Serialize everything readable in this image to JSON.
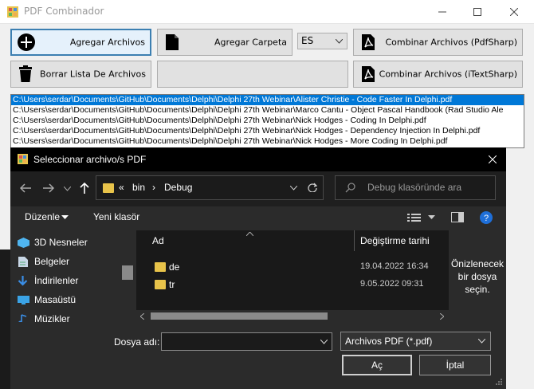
{
  "main": {
    "title": "PDF Combinador",
    "buttons": {
      "add_files": "Agregar Archivos",
      "add_folder": "Agregar Carpeta",
      "language": "ES",
      "combine_pdfsharp": "Combinar Archivos (PdfSharp)",
      "clear_list": "Borrar Lista De Archivos",
      "combine_itextsharp": "Combinar Archivos (iTextSharp)"
    },
    "files": [
      "C:\\Users\\serdar\\Documents\\GitHub\\Documents\\Delphi\\Delphi 27th Webinar\\Alister Christie - Code Faster In Delphi.pdf",
      "C:\\Users\\serdar\\Documents\\GitHub\\Documents\\Delphi\\Delphi 27th Webinar\\Marco Cantu - Object Pascal Handbook (Rad Studio Ale",
      "C:\\Users\\serdar\\Documents\\GitHub\\Documents\\Delphi\\Delphi 27th Webinar\\Nick Hodges - Coding In Delphi.pdf",
      "C:\\Users\\serdar\\Documents\\GitHub\\Documents\\Delphi\\Delphi 27th Webinar\\Nick Hodges - Dependency Injection In Delphi.pdf",
      "C:\\Users\\serdar\\Documents\\GitHub\\Documents\\Delphi\\Delphi 27th Webinar\\Nick Hodges - More Coding In Delphi.pdf"
    ]
  },
  "dialog": {
    "title": "Seleccionar archivo/s PDF",
    "breadcrumb": {
      "overflow": "«",
      "part1": "bin",
      "sep": "›",
      "part2": "Debug"
    },
    "search_placeholder": "Debug klasöründe ara",
    "organize": "Düzenle",
    "new_folder": "Yeni klasör",
    "nav_items": [
      "3D Nesneler",
      "Belgeler",
      "İndirilenler",
      "Masaüstü",
      "Müzikler"
    ],
    "columns": {
      "name": "Ad",
      "date": "Değiştirme tarihi"
    },
    "rows": [
      {
        "name": "de",
        "date": "19.04.2022 16:34"
      },
      {
        "name": "tr",
        "date": "9.05.2022 09:31"
      }
    ],
    "preview_text": "Önizlenecek bir dosya seçin.",
    "filename_label": "Dosya adı:",
    "filename_value": "",
    "filter": "Archivos PDF (*.pdf)",
    "open_button": "Aç",
    "cancel_button": "İptal"
  }
}
